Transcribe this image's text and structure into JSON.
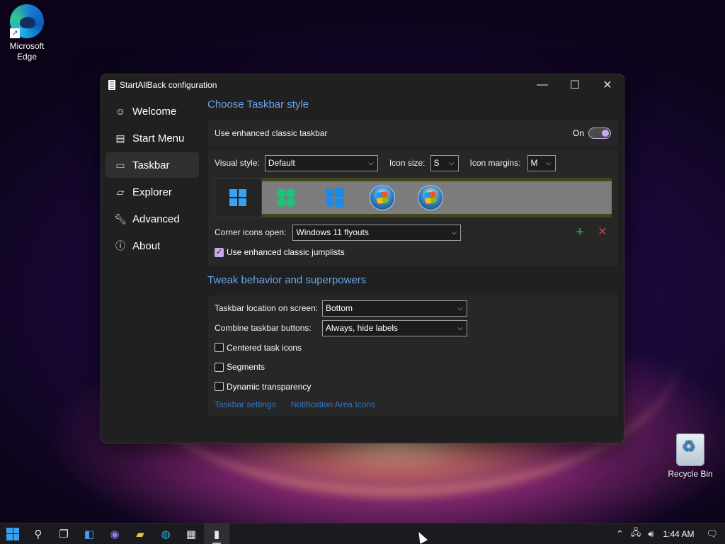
{
  "desktop": {
    "icons": [
      {
        "label": "Microsoft Edge"
      },
      {
        "label": "Recycle Bin"
      }
    ]
  },
  "window": {
    "title": "StartAllBack configuration",
    "controls": {
      "minimize": "—",
      "maximize": "☐",
      "close": "✕"
    }
  },
  "sidebar": {
    "items": [
      {
        "label": "Welcome",
        "icon": "smile-icon"
      },
      {
        "label": "Start Menu",
        "icon": "start-menu-icon"
      },
      {
        "label": "Taskbar",
        "icon": "taskbar-icon",
        "active": true
      },
      {
        "label": "Explorer",
        "icon": "folder-icon"
      },
      {
        "label": "Advanced",
        "icon": "wrench-icon"
      },
      {
        "label": "About",
        "icon": "info-icon"
      }
    ]
  },
  "taskbar_style": {
    "heading": "Choose Taskbar style",
    "enhanced_label": "Use enhanced classic taskbar",
    "enhanced_state": "On",
    "visual_style_label": "Visual style:",
    "visual_style_value": "Default",
    "icon_size_label": "Icon size:",
    "icon_size_value": "S",
    "icon_margins_label": "Icon margins:",
    "icon_margins_value": "M",
    "corner_icons_label": "Corner icons open:",
    "corner_icons_value": "Windows 11 flyouts",
    "jumplists_label": "Use enhanced classic jumplists",
    "jumplists_checked": true,
    "add_symbol": "+",
    "remove_symbol": "✕"
  },
  "tweak": {
    "heading": "Tweak behavior and superpowers",
    "location_label": "Taskbar location on screen:",
    "location_value": "Bottom",
    "combine_label": "Combine taskbar buttons:",
    "combine_value": "Always, hide labels",
    "centered_label": "Centered task icons",
    "segments_label": "Segments",
    "dynamic_label": "Dynamic transparency",
    "link_taskbar_settings": "Taskbar settings",
    "link_notification_icons": "Notification Area Icons"
  },
  "taskbar": {
    "clock": "1:44 AM"
  },
  "colors": {
    "accent": "#c8a8e8",
    "heading": "#6aa4e8",
    "link": "#2f76c8",
    "add": "#3aa83a",
    "remove": "#c84040"
  }
}
